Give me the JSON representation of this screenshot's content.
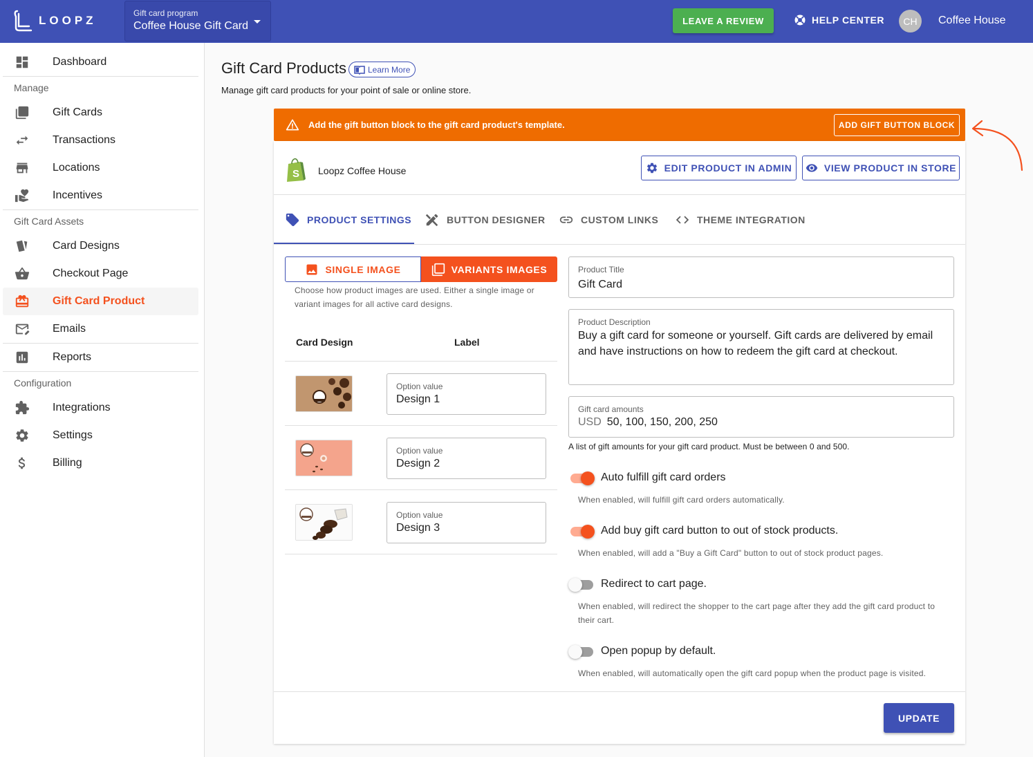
{
  "brand": {
    "name": "LOOPZ",
    "primary": "#3f51b5",
    "accent": "#f4511e",
    "warning": "#ef6c00",
    "success": "#4caf50"
  },
  "header": {
    "program_label": "Gift card program",
    "program_value": "Coffee House Gift Card",
    "review_label": "LEAVE A REVIEW",
    "help_label": "HELP CENTER",
    "avatar_initials": "CH",
    "user_name": "Coffee House"
  },
  "sidebar": {
    "dashboard": "Dashboard",
    "section_manage": "Manage",
    "gift_cards": "Gift Cards",
    "transactions": "Transactions",
    "locations": "Locations",
    "incentives": "Incentives",
    "section_assets": "Gift Card Assets",
    "card_designs": "Card Designs",
    "checkout_page": "Checkout Page",
    "gift_card_product": "Gift Card Product",
    "emails": "Emails",
    "reports": "Reports",
    "section_config": "Configuration",
    "integrations": "Integrations",
    "settings": "Settings",
    "billing": "Billing"
  },
  "page": {
    "title": "Gift Card Products",
    "learn_more": "Learn More",
    "subtitle": "Manage gift card products for your point of sale or online store."
  },
  "alert": {
    "text": "Add the gift button block to the gift card product's template.",
    "button": "ADD GIFT BUTTON BLOCK"
  },
  "shop": {
    "name": "Loopz Coffee House",
    "edit_button": "EDIT PRODUCT IN ADMIN",
    "view_button": "VIEW PRODUCT IN STORE"
  },
  "tabs": {
    "product_settings": "PRODUCT SETTINGS",
    "button_designer": "BUTTON DESIGNER",
    "custom_links": "CUSTOM LINKS",
    "theme_integration": "THEME INTEGRATION"
  },
  "images": {
    "single": "SINGLE IMAGE",
    "variants": "VARIANTS IMAGES",
    "selected": "VARIANTS IMAGES",
    "help": "Choose how product images are used. Either a single image or variant images for all active card designs."
  },
  "table": {
    "col_design": "Card Design",
    "col_label": "Label",
    "rows": [
      {
        "option_label": "Option value",
        "option_value": "Design 1"
      },
      {
        "option_label": "Option value",
        "option_value": "Design 2"
      },
      {
        "option_label": "Option value",
        "option_value": "Design 3"
      }
    ]
  },
  "form": {
    "title_label": "Product Title",
    "title_value": "Gift Card",
    "desc_label": "Product Description",
    "desc_value": "Buy a gift card for someone or yourself. Gift cards are delivered by email and have instructions on how to redeem the gift card at checkout.",
    "amounts_label": "Gift card amounts",
    "currency": "USD",
    "amounts_value": "50, 100, 150, 200, 250",
    "amounts_help": "A list of gift amounts for your gift card product. Must be between 0 and 500."
  },
  "switches": [
    {
      "label": "Auto fulfill gift card orders",
      "help": "When enabled, will fulfill gift card orders automatically.",
      "on": true
    },
    {
      "label": "Add buy gift card button to out of stock products.",
      "help": "When enabled, will add a \"Buy a Gift Card\" button to out of stock product pages.",
      "on": true
    },
    {
      "label": "Redirect to cart page.",
      "help": "When enabled, will redirect the shopper to the cart page after they add the gift card product to their cart.",
      "on": false
    },
    {
      "label": "Open popup by default.",
      "help": "When enabled, will automatically open the gift card popup when the product page is visited.",
      "on": false
    }
  ],
  "update_button": "UPDATE"
}
